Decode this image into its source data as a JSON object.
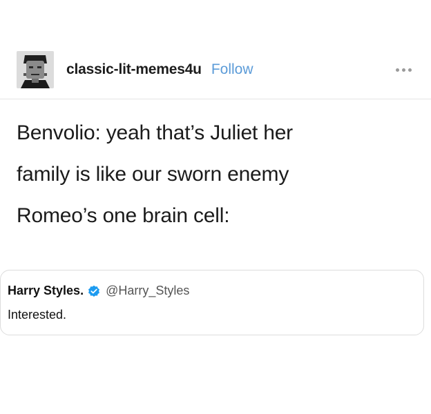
{
  "post": {
    "blog_name": "classic-lit-memes4u",
    "follow_label": "Follow",
    "lines": [
      "Benvolio: yeah that’s Juliet her",
      "family is like our sworn enemy",
      "Romeo’s one brain cell:"
    ]
  },
  "tweet": {
    "display_name": "Harry Styles.",
    "handle": "@Harry_Styles",
    "text": "Interested.",
    "verified_color": "#1d9bf0"
  },
  "icons": {
    "avatar": "frankenstein-avatar",
    "more": "more-options-icon",
    "verified": "verified-badge-icon"
  },
  "colors": {
    "follow": "#5b9bd8",
    "text": "#1b1b1b"
  }
}
